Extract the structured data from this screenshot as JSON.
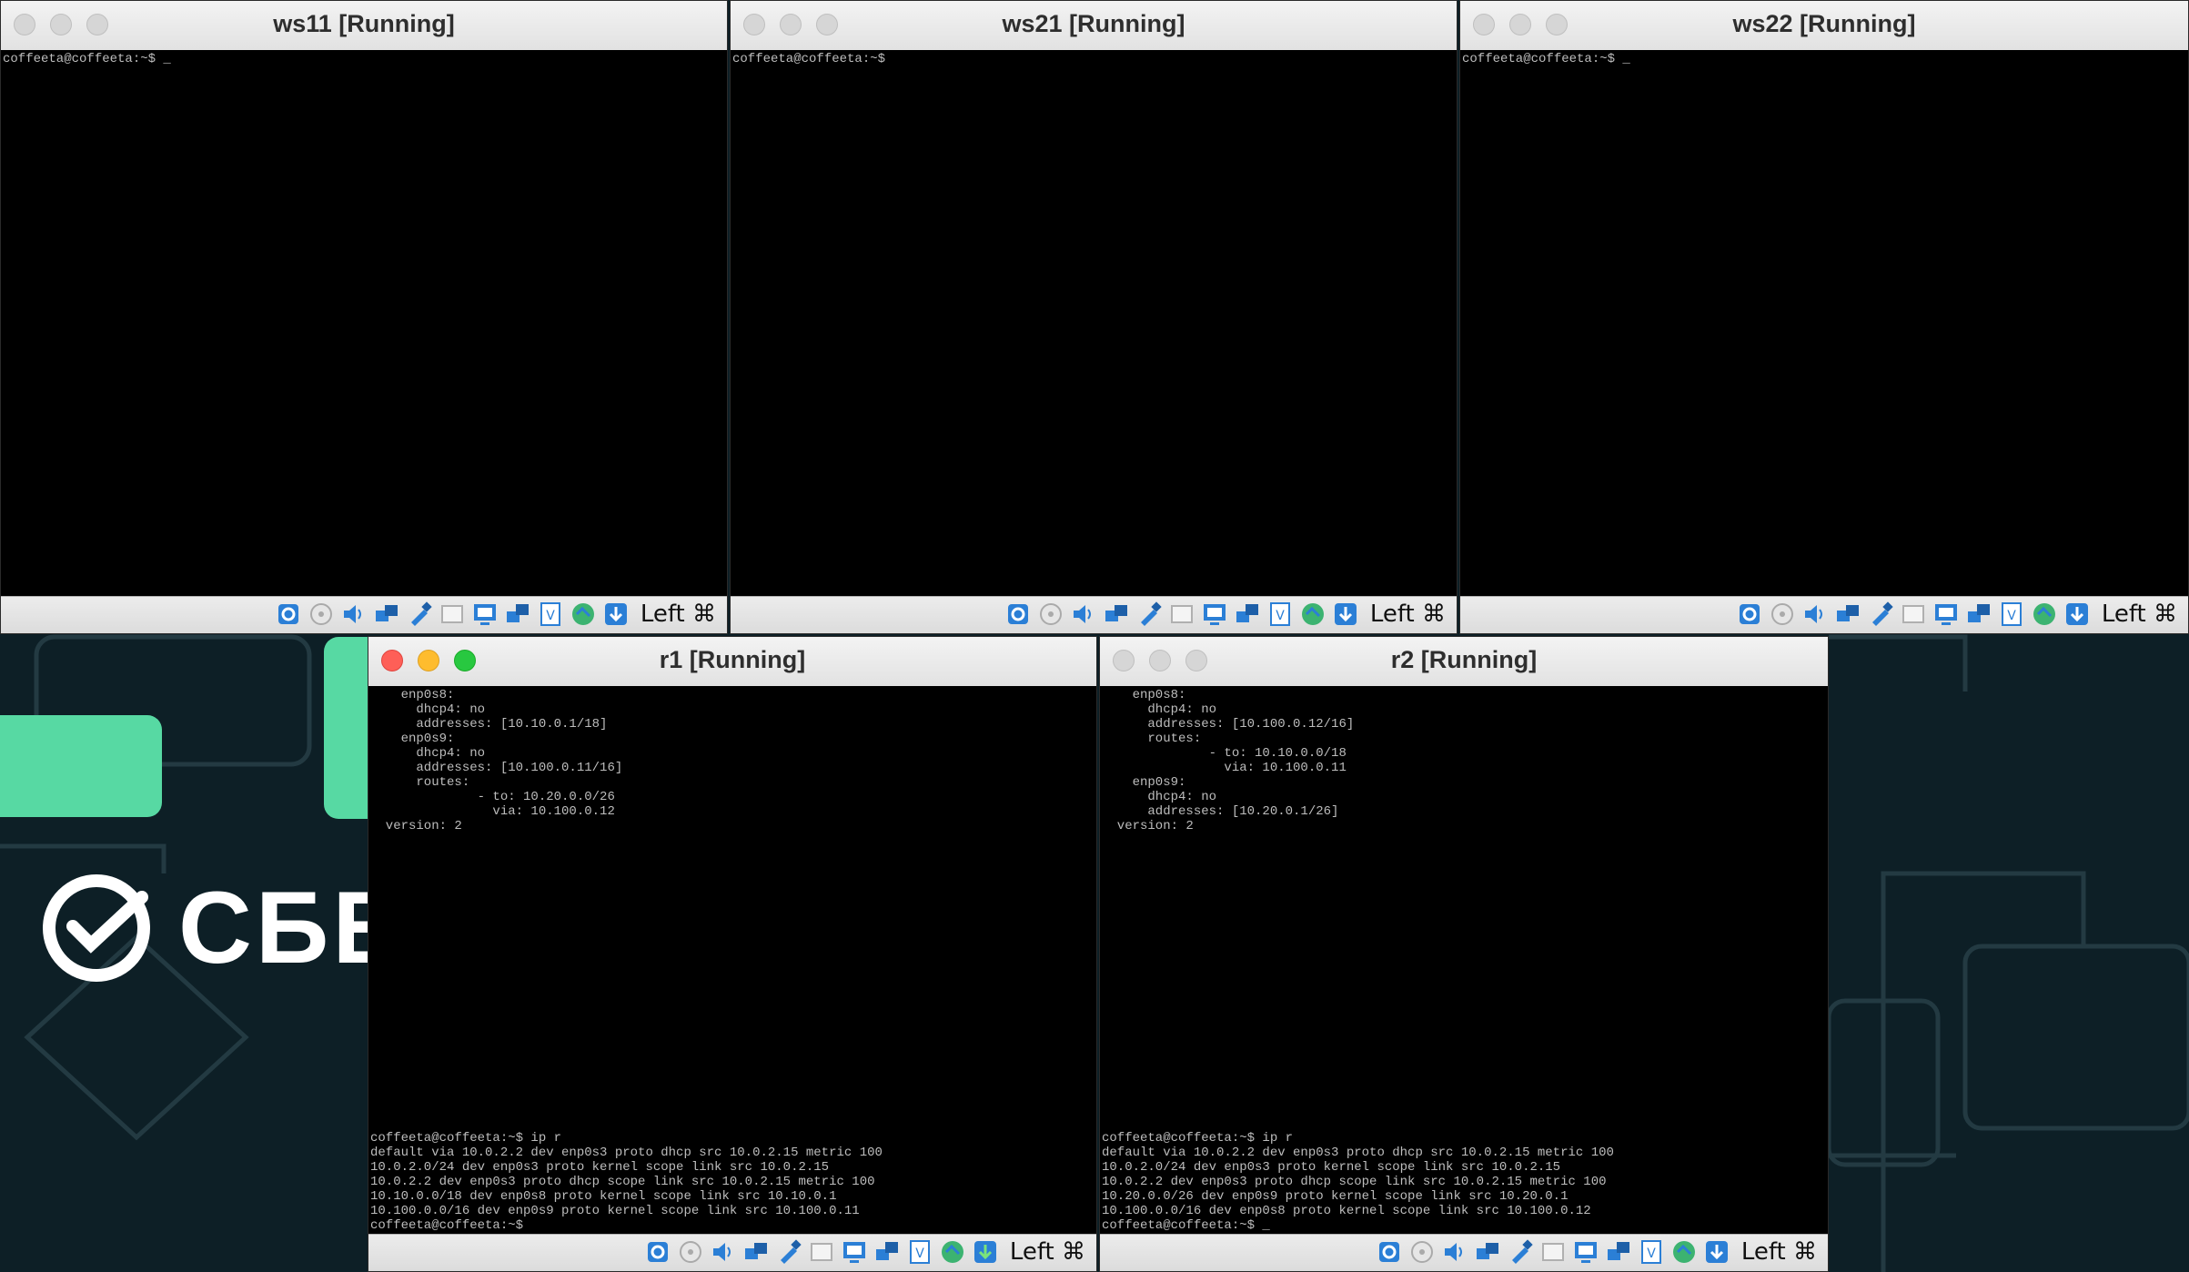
{
  "desktop": {
    "brand": "СБЕ",
    "accent_color": "#57d9a3",
    "background_color": "#0d1f26"
  },
  "windows": [
    {
      "id": "ws11",
      "title": "ws11 [Running]",
      "focused": false,
      "terminal_top": "coffeeta@coffeeta:~$ _",
      "terminal_bottom": "",
      "host_key": "Left ⌘"
    },
    {
      "id": "ws21",
      "title": "ws21 [Running]",
      "focused": false,
      "terminal_top": "coffeeta@coffeeta:~$",
      "terminal_bottom": "",
      "host_key": "Left ⌘"
    },
    {
      "id": "ws22",
      "title": "ws22 [Running]",
      "focused": false,
      "terminal_top": "coffeeta@coffeeta:~$ _",
      "terminal_bottom": "",
      "host_key": "Left ⌘"
    },
    {
      "id": "r1",
      "title": "r1 [Running]",
      "focused": true,
      "terminal_top": "    enp0s8:\n      dhcp4: no\n      addresses: [10.10.0.1/18]\n    enp0s9:\n      dhcp4: no\n      addresses: [10.100.0.11/16]\n      routes:\n              - to: 10.20.0.0/26\n                via: 10.100.0.12\n  version: 2",
      "terminal_bottom": "coffeeta@coffeeta:~$ ip r\ndefault via 10.0.2.2 dev enp0s3 proto dhcp src 10.0.2.15 metric 100\n10.0.2.0/24 dev enp0s3 proto kernel scope link src 10.0.2.15\n10.0.2.2 dev enp0s3 proto dhcp scope link src 10.0.2.15 metric 100\n10.10.0.0/18 dev enp0s8 proto kernel scope link src 10.10.0.1\n10.100.0.0/16 dev enp0s9 proto kernel scope link src 10.100.0.11\ncoffeeta@coffeeta:~$",
      "host_key": "Left ⌘"
    },
    {
      "id": "r2",
      "title": "r2 [Running]",
      "focused": false,
      "terminal_top": "    enp0s8:\n      dhcp4: no\n      addresses: [10.100.0.12/16]\n      routes:\n              - to: 10.10.0.0/18\n                via: 10.100.0.11\n    enp0s9:\n      dhcp4: no\n      addresses: [10.20.0.1/26]\n  version: 2",
      "terminal_bottom": "coffeeta@coffeeta:~$ ip r\ndefault via 10.0.2.2 dev enp0s3 proto dhcp src 10.0.2.15 metric 100\n10.0.2.0/24 dev enp0s3 proto kernel scope link src 10.0.2.15\n10.0.2.2 dev enp0s3 proto dhcp scope link src 10.0.2.15 metric 100\n10.20.0.0/26 dev enp0s9 proto kernel scope link src 10.20.0.1\n10.100.0.0/16 dev enp0s8 proto kernel scope link src 10.100.0.12\ncoffeeta@coffeeta:~$ _",
      "host_key": "Left ⌘"
    }
  ],
  "status_icons": [
    "hard-disk-icon",
    "optical-drive-icon",
    "audio-icon",
    "network-icon",
    "usb-icon",
    "shared-folder-icon",
    "display-icon",
    "video-capture-icon",
    "recording-icon",
    "cpu-icon",
    "mouse-integration-icon",
    "keyboard-capture-icon"
  ]
}
